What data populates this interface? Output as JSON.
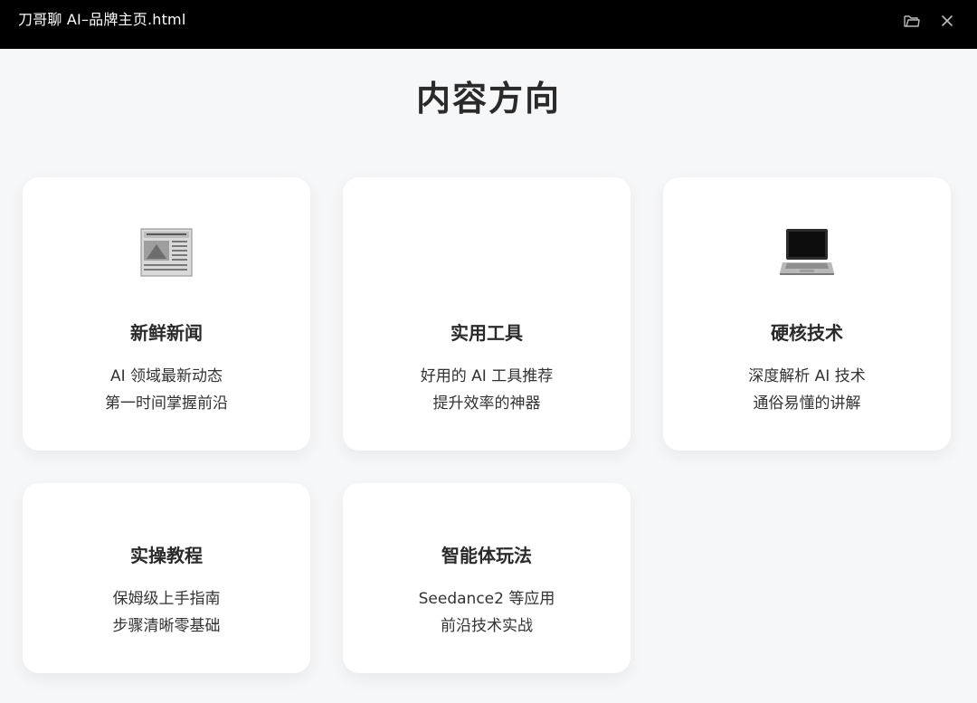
{
  "window": {
    "title": "刀哥聊 AI–品牌主页.html",
    "folder_icon": "folder-icon",
    "close_icon": "close-icon"
  },
  "page": {
    "heading": "内容方向"
  },
  "cards": [
    {
      "icon": "newspaper-icon",
      "title": "新鲜新闻",
      "lines": [
        "AI 领域最新动态",
        "第一时间掌握前沿"
      ]
    },
    {
      "icon": "",
      "title": "实用工具",
      "lines": [
        "好用的 AI 工具推荐",
        "提升效率的神器"
      ]
    },
    {
      "icon": "laptop-icon",
      "title": "硬核技术",
      "lines": [
        "深度解析 AI 技术",
        "通俗易懂的讲解"
      ]
    },
    {
      "icon": "",
      "title": "实操教程",
      "lines": [
        "保姆级上手指南",
        "步骤清晰零基础"
      ]
    },
    {
      "icon": "",
      "title": "智能体玩法",
      "lines": [
        "Seedance2 等应用",
        "前沿技术实战"
      ]
    }
  ],
  "colors": {
    "titlebar_bg": "#000000",
    "page_bg": "#f6f7f9",
    "card_bg": "#ffffff",
    "text_dark": "#2a2a2a"
  }
}
